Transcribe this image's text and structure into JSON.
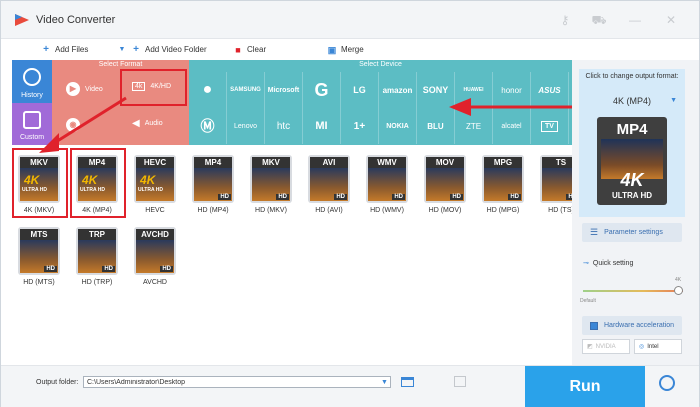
{
  "window": {
    "title": "Video Converter"
  },
  "toolbar": {
    "add_files": "Add Files",
    "add_video_folder": "Add Video Folder",
    "clear": "Clear",
    "merge": "Merge"
  },
  "side_tabs": {
    "history": "History",
    "custom": "Custom"
  },
  "format_panel": {
    "heading": "Select Format",
    "video": "Video",
    "k4hd": "4K/HD",
    "audio": "Audio",
    "k4_icon_text": "4k"
  },
  "device_panel": {
    "heading": "Select Device",
    "row1": [
      "",
      "SAMSUNG",
      "Microsoft",
      "G",
      "LG",
      "amazon",
      "SONY",
      "HUAWEI",
      "honor",
      "ASUS"
    ],
    "row2": [
      "",
      "Lenovo",
      "htc",
      "MI",
      "1+",
      "NOKIA",
      "BLU",
      "ZTE",
      "alcatel",
      "TV"
    ]
  },
  "formats": [
    {
      "tag": "MKV",
      "mark": "4K",
      "sub": "ULTRA HD",
      "label": "4K (MKV)"
    },
    {
      "tag": "MP4",
      "mark": "4K",
      "sub": "ULTRA HD",
      "label": "4K (MP4)"
    },
    {
      "tag": "HEVC",
      "mark": "4K",
      "sub": "ULTRA HD",
      "label": "HEVC"
    },
    {
      "tag": "MP4",
      "mark": "",
      "sub": "",
      "hd": "HD",
      "label": "HD (MP4)"
    },
    {
      "tag": "MKV",
      "mark": "",
      "sub": "",
      "hd": "HD",
      "label": "HD (MKV)"
    },
    {
      "tag": "AVI",
      "mark": "",
      "sub": "",
      "hd": "HD",
      "label": "HD (AVI)"
    },
    {
      "tag": "WMV",
      "mark": "",
      "sub": "",
      "hd": "HD",
      "label": "HD (WMV)"
    },
    {
      "tag": "MOV",
      "mark": "",
      "sub": "",
      "hd": "HD",
      "label": "HD (MOV)"
    },
    {
      "tag": "MPG",
      "mark": "",
      "sub": "",
      "hd": "HD",
      "label": "HD (MPG)"
    },
    {
      "tag": "TS",
      "mark": "",
      "sub": "",
      "hd": "HD",
      "label": "HD (TS)"
    },
    {
      "tag": "MTS",
      "mark": "",
      "sub": "",
      "hd": "HD",
      "label": "HD (MTS)"
    },
    {
      "tag": "TRP",
      "mark": "",
      "sub": "",
      "hd": "HD",
      "label": "HD (TRP)"
    },
    {
      "tag": "AVCHD",
      "mark": "",
      "sub": "",
      "hd": "HD",
      "label": "AVCHD"
    }
  ],
  "output": {
    "title": "Click to change output format:",
    "format": "4K (MP4)",
    "thumb_tag": "MP4",
    "thumb_mark": "4K",
    "thumb_sub": "ULTRA HD"
  },
  "settings": {
    "parameter": "Parameter settings",
    "quick": "Quick setting",
    "label_4k": "4K",
    "label_default": "Default",
    "quick_level": 1.0,
    "hw_accel": "Hardware acceleration",
    "nvidia": "NVIDIA",
    "intel": "Intel"
  },
  "bottom": {
    "output_folder_label": "Output folder:",
    "output_folder_value": "C:\\Users\\Administrator\\Desktop",
    "run": "Run"
  },
  "colors": {
    "accent": "#2aa2ea",
    "highlight": "#e0222b",
    "format_panel": "#e98a80",
    "device_panel": "#5cbdc4"
  }
}
